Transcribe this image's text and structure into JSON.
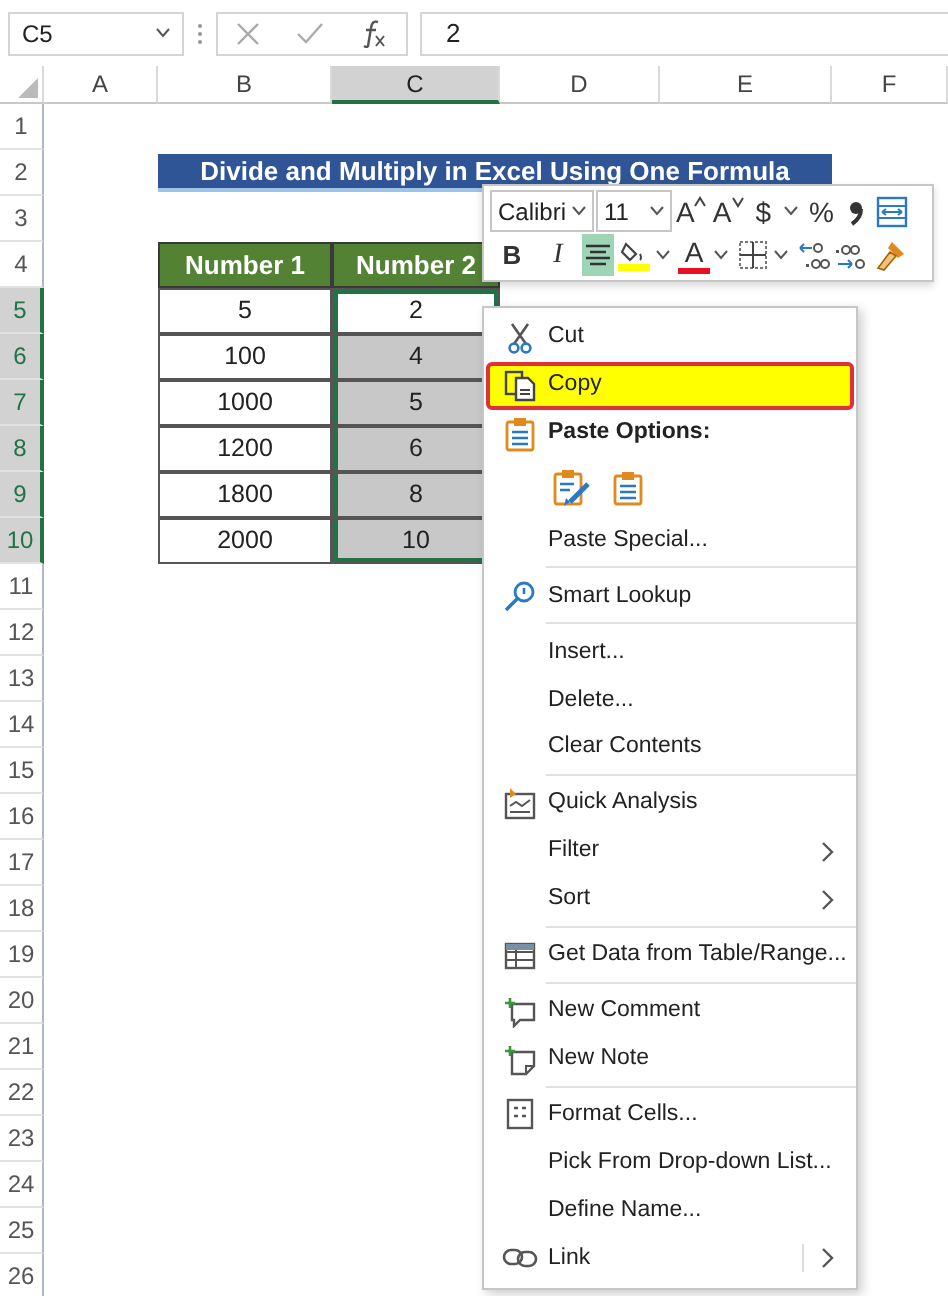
{
  "formula_bar": {
    "name_box": "C5",
    "formula": "2"
  },
  "columns": [
    {
      "label": "A",
      "selected": false
    },
    {
      "label": "B",
      "selected": false
    },
    {
      "label": "C",
      "selected": true
    },
    {
      "label": "D",
      "selected": false
    },
    {
      "label": "E",
      "selected": false
    },
    {
      "label": "F",
      "selected": false
    }
  ],
  "rows": [
    {
      "label": "1",
      "selected": false
    },
    {
      "label": "2",
      "selected": false
    },
    {
      "label": "3",
      "selected": false
    },
    {
      "label": "4",
      "selected": false
    },
    {
      "label": "5",
      "selected": true
    },
    {
      "label": "6",
      "selected": true
    },
    {
      "label": "7",
      "selected": true
    },
    {
      "label": "8",
      "selected": true
    },
    {
      "label": "9",
      "selected": true
    },
    {
      "label": "10",
      "selected": true
    },
    {
      "label": "11",
      "selected": false
    },
    {
      "label": "12",
      "selected": false
    },
    {
      "label": "13",
      "selected": false
    },
    {
      "label": "14",
      "selected": false
    },
    {
      "label": "15",
      "selected": false
    },
    {
      "label": "16",
      "selected": false
    },
    {
      "label": "17",
      "selected": false
    },
    {
      "label": "18",
      "selected": false
    },
    {
      "label": "19",
      "selected": false
    },
    {
      "label": "20",
      "selected": false
    },
    {
      "label": "21",
      "selected": false
    },
    {
      "label": "22",
      "selected": false
    },
    {
      "label": "23",
      "selected": false
    },
    {
      "label": "24",
      "selected": false
    },
    {
      "label": "25",
      "selected": false
    },
    {
      "label": "26",
      "selected": false
    }
  ],
  "title": "Divide and Multiply in Excel Using One Formula",
  "table": {
    "headers": [
      "Number 1",
      "Number 2"
    ],
    "rows": [
      [
        {
          "value": "5",
          "shaded": false,
          "selected": false
        },
        {
          "value": "2",
          "shaded": false,
          "selected": true
        }
      ],
      [
        {
          "value": "100",
          "shaded": false,
          "selected": false
        },
        {
          "value": "4",
          "shaded": true,
          "selected": true
        }
      ],
      [
        {
          "value": "1000",
          "shaded": false,
          "selected": false
        },
        {
          "value": "5",
          "shaded": true,
          "selected": true
        }
      ],
      [
        {
          "value": "1200",
          "shaded": false,
          "selected": false
        },
        {
          "value": "6",
          "shaded": true,
          "selected": true
        }
      ],
      [
        {
          "value": "1800",
          "shaded": false,
          "selected": false
        },
        {
          "value": "8",
          "shaded": true,
          "selected": true
        }
      ],
      [
        {
          "value": "2000",
          "shaded": false,
          "selected": false
        },
        {
          "value": "10",
          "shaded": true,
          "selected": true
        }
      ]
    ]
  },
  "mini_toolbar": {
    "top_row": [
      {
        "kind": "select",
        "value": "Calibri"
      },
      {
        "kind": "select",
        "value": "11"
      },
      {
        "kind": "text",
        "label": "A",
        "selected": false
      },
      {
        "kind": "text",
        "label": "A",
        "selected": false
      },
      {
        "kind": "text",
        "label": "$",
        "dropdown": true,
        "selected": false
      },
      {
        "kind": "text",
        "label": "%",
        "selected": false
      },
      {
        "kind": "icon",
        "selected": false
      },
      {
        "kind": "icon",
        "selected": false
      }
    ],
    "bottom_row": [
      {
        "kind": "bold",
        "label": "B",
        "selected": false
      },
      {
        "kind": "italic",
        "label": "I",
        "selected": false
      },
      {
        "kind": "icon",
        "selected": true
      },
      {
        "kind": "icon",
        "dropdown": true,
        "selected": false
      },
      {
        "kind": "color_text",
        "label": "A",
        "color": "#e81123",
        "dropdown": true,
        "selected": false
      },
      {
        "kind": "icon",
        "dropdown": true,
        "selected": false
      },
      {
        "kind": "icon",
        "selected": false
      },
      {
        "kind": "icon",
        "selected": false
      },
      {
        "kind": "icon",
        "selected": false
      }
    ]
  },
  "context_menu": [
    {
      "kind": "item",
      "label": "Cut",
      "selected": false
    },
    {
      "kind": "item",
      "label": "Copy",
      "selected": true
    },
    {
      "kind": "heading",
      "label": "Paste Options:"
    },
    {
      "kind": "paste_icons",
      "options": [
        {
          "kind": "formatting"
        },
        {
          "kind": "values"
        }
      ]
    },
    {
      "kind": "item",
      "label": "Paste Special...",
      "selected": false
    },
    {
      "kind": "separator"
    },
    {
      "kind": "item",
      "label": "Smart Lookup",
      "selected": false
    },
    {
      "kind": "separator"
    },
    {
      "kind": "item",
      "label": "Insert...",
      "selected": false
    },
    {
      "kind": "item",
      "label": "Delete...",
      "selected": false
    },
    {
      "kind": "item",
      "label": "Clear Contents",
      "selected": false
    },
    {
      "kind": "separator"
    },
    {
      "kind": "item",
      "label": "Quick Analysis",
      "selected": false
    },
    {
      "kind": "item",
      "label": "Filter",
      "submenu": true,
      "selected": false
    },
    {
      "kind": "item",
      "label": "Sort",
      "submenu": true,
      "selected": false
    },
    {
      "kind": "separator"
    },
    {
      "kind": "item",
      "label": "Get Data from Table/Range...",
      "selected": false
    },
    {
      "kind": "separator"
    },
    {
      "kind": "item",
      "label": "New Comment",
      "selected": false
    },
    {
      "kind": "item",
      "label": "New Note",
      "selected": false
    },
    {
      "kind": "separator"
    },
    {
      "kind": "item",
      "label": "Format Cells...",
      "selected": false
    },
    {
      "kind": "item",
      "label": "Pick From Drop-down List...",
      "selected": false
    },
    {
      "kind": "item",
      "label": "Define Name...",
      "selected": false
    },
    {
      "kind": "item",
      "label": "Link",
      "submenu": true,
      "split": true,
      "selected": false
    }
  ]
}
